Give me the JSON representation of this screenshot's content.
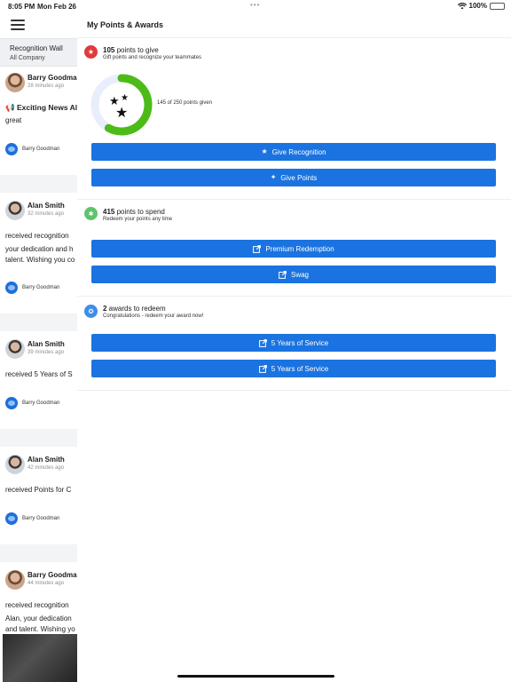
{
  "status_bar": {
    "time": "8:05 PM",
    "date": "Mon Feb 26",
    "dots": "•••",
    "battery": "100%"
  },
  "feed": {
    "menu_icon": "hamburger-icon",
    "header_title": "Recognition Wall",
    "header_subtitle": "All Company",
    "posts": [
      {
        "author": "Barry Goodman",
        "time": "28 minutes ago",
        "line1": "📢 Exciting News Ale",
        "line2": "great",
        "footer": "Barry Goodman"
      },
      {
        "author": "Alan Smith",
        "time": "32 minutes ago",
        "line1": "received recognition",
        "line2": "your dedication and h",
        "line3": "talent. Wishing you co",
        "footer": "Barry Goodman"
      },
      {
        "author": "Alan Smith",
        "time": "39 minutes ago",
        "line1": "received 5 Years of S",
        "footer": "Barry Goodman"
      },
      {
        "author": "Alan Smith",
        "time": "42 minutes ago",
        "line1": "received Points for C",
        "footer": "Barry Goodman"
      },
      {
        "author": "Barry Goodman",
        "time": "44 minutes ago",
        "line1": "received recognition",
        "line2": "Alan, your dedication",
        "line3": "and talent. Wishing yo"
      }
    ]
  },
  "main": {
    "title": "My Points & Awards",
    "give": {
      "count": "105",
      "head_rest": " points to give",
      "subtitle": "Gift points and recognize your teammates",
      "progress_label": "145 of 250 points given",
      "given": 145,
      "total": 250,
      "btn_recognition": "Give Recognition",
      "btn_points": "Give Points",
      "accent": "#4cbb17"
    },
    "spend": {
      "count": "415",
      "head_rest": " points to spend",
      "subtitle": "Redeem your points any time",
      "btn_premium": "Premium Redemption",
      "btn_swag": "Swag"
    },
    "awards": {
      "count": "2",
      "head_rest": " awards to redeem",
      "subtitle": "Congratulations - redeem your award now!",
      "btn_award_1": "5 Years of Service",
      "btn_award_2": "5 Years of Service"
    }
  },
  "colors": {
    "primary": "#1a73e0",
    "give_icon": "#e03b3b",
    "spend_icon": "#5cc46e",
    "awards_icon": "#3d8ee6"
  }
}
